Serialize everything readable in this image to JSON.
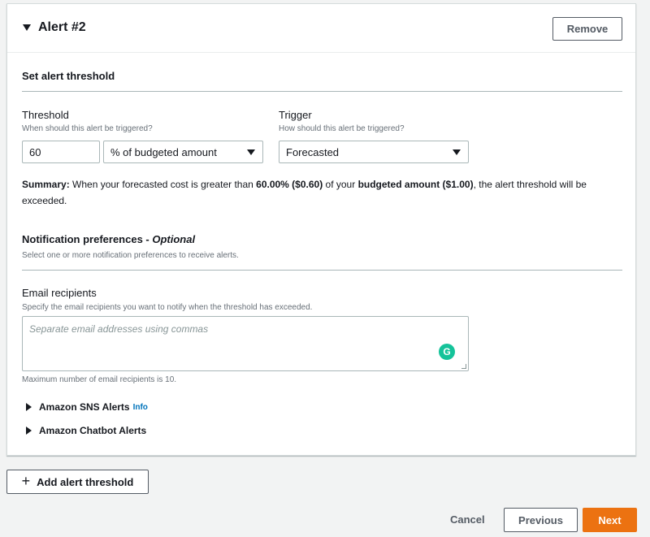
{
  "alert": {
    "title": "Alert #2",
    "remove_label": "Remove"
  },
  "threshold_section": {
    "title": "Set alert threshold",
    "threshold_label": "Threshold",
    "threshold_sublabel": "When should this alert be triggered?",
    "threshold_value": "60",
    "threshold_unit": "% of budgeted amount",
    "trigger_label": "Trigger",
    "trigger_sublabel": "How should this alert be triggered?",
    "trigger_value": "Forecasted"
  },
  "summary": {
    "prefix": "Summary:",
    "text1": " When your forecasted cost is greater than ",
    "pct": "60.00% ($0.60)",
    "text2": " of your ",
    "budget": "budgeted amount ($1.00)",
    "text3": ", the alert threshold will be exceeded."
  },
  "notification": {
    "title": "Notification preferences - ",
    "title_optional": "Optional",
    "description": "Select one or more notification preferences to receive alerts.",
    "email_label": "Email recipients",
    "email_sublabel": "Specify the email recipients you want to notify when the threshold has exceeded.",
    "email_placeholder": "Separate email addresses using commas",
    "email_hint": "Maximum number of email recipients is 10.",
    "grammarly_glyph": "G"
  },
  "expanders": {
    "sns_label": "Amazon SNS Alerts",
    "sns_info": "Info",
    "chatbot_label": "Amazon Chatbot Alerts"
  },
  "footer": {
    "add_label": "Add alert threshold",
    "plus_glyph": "+",
    "cancel_label": "Cancel",
    "previous_label": "Previous",
    "next_label": "Next"
  },
  "colors": {
    "primary": "#ec7211",
    "link": "#0073bb",
    "grammarly": "#15c39a"
  }
}
